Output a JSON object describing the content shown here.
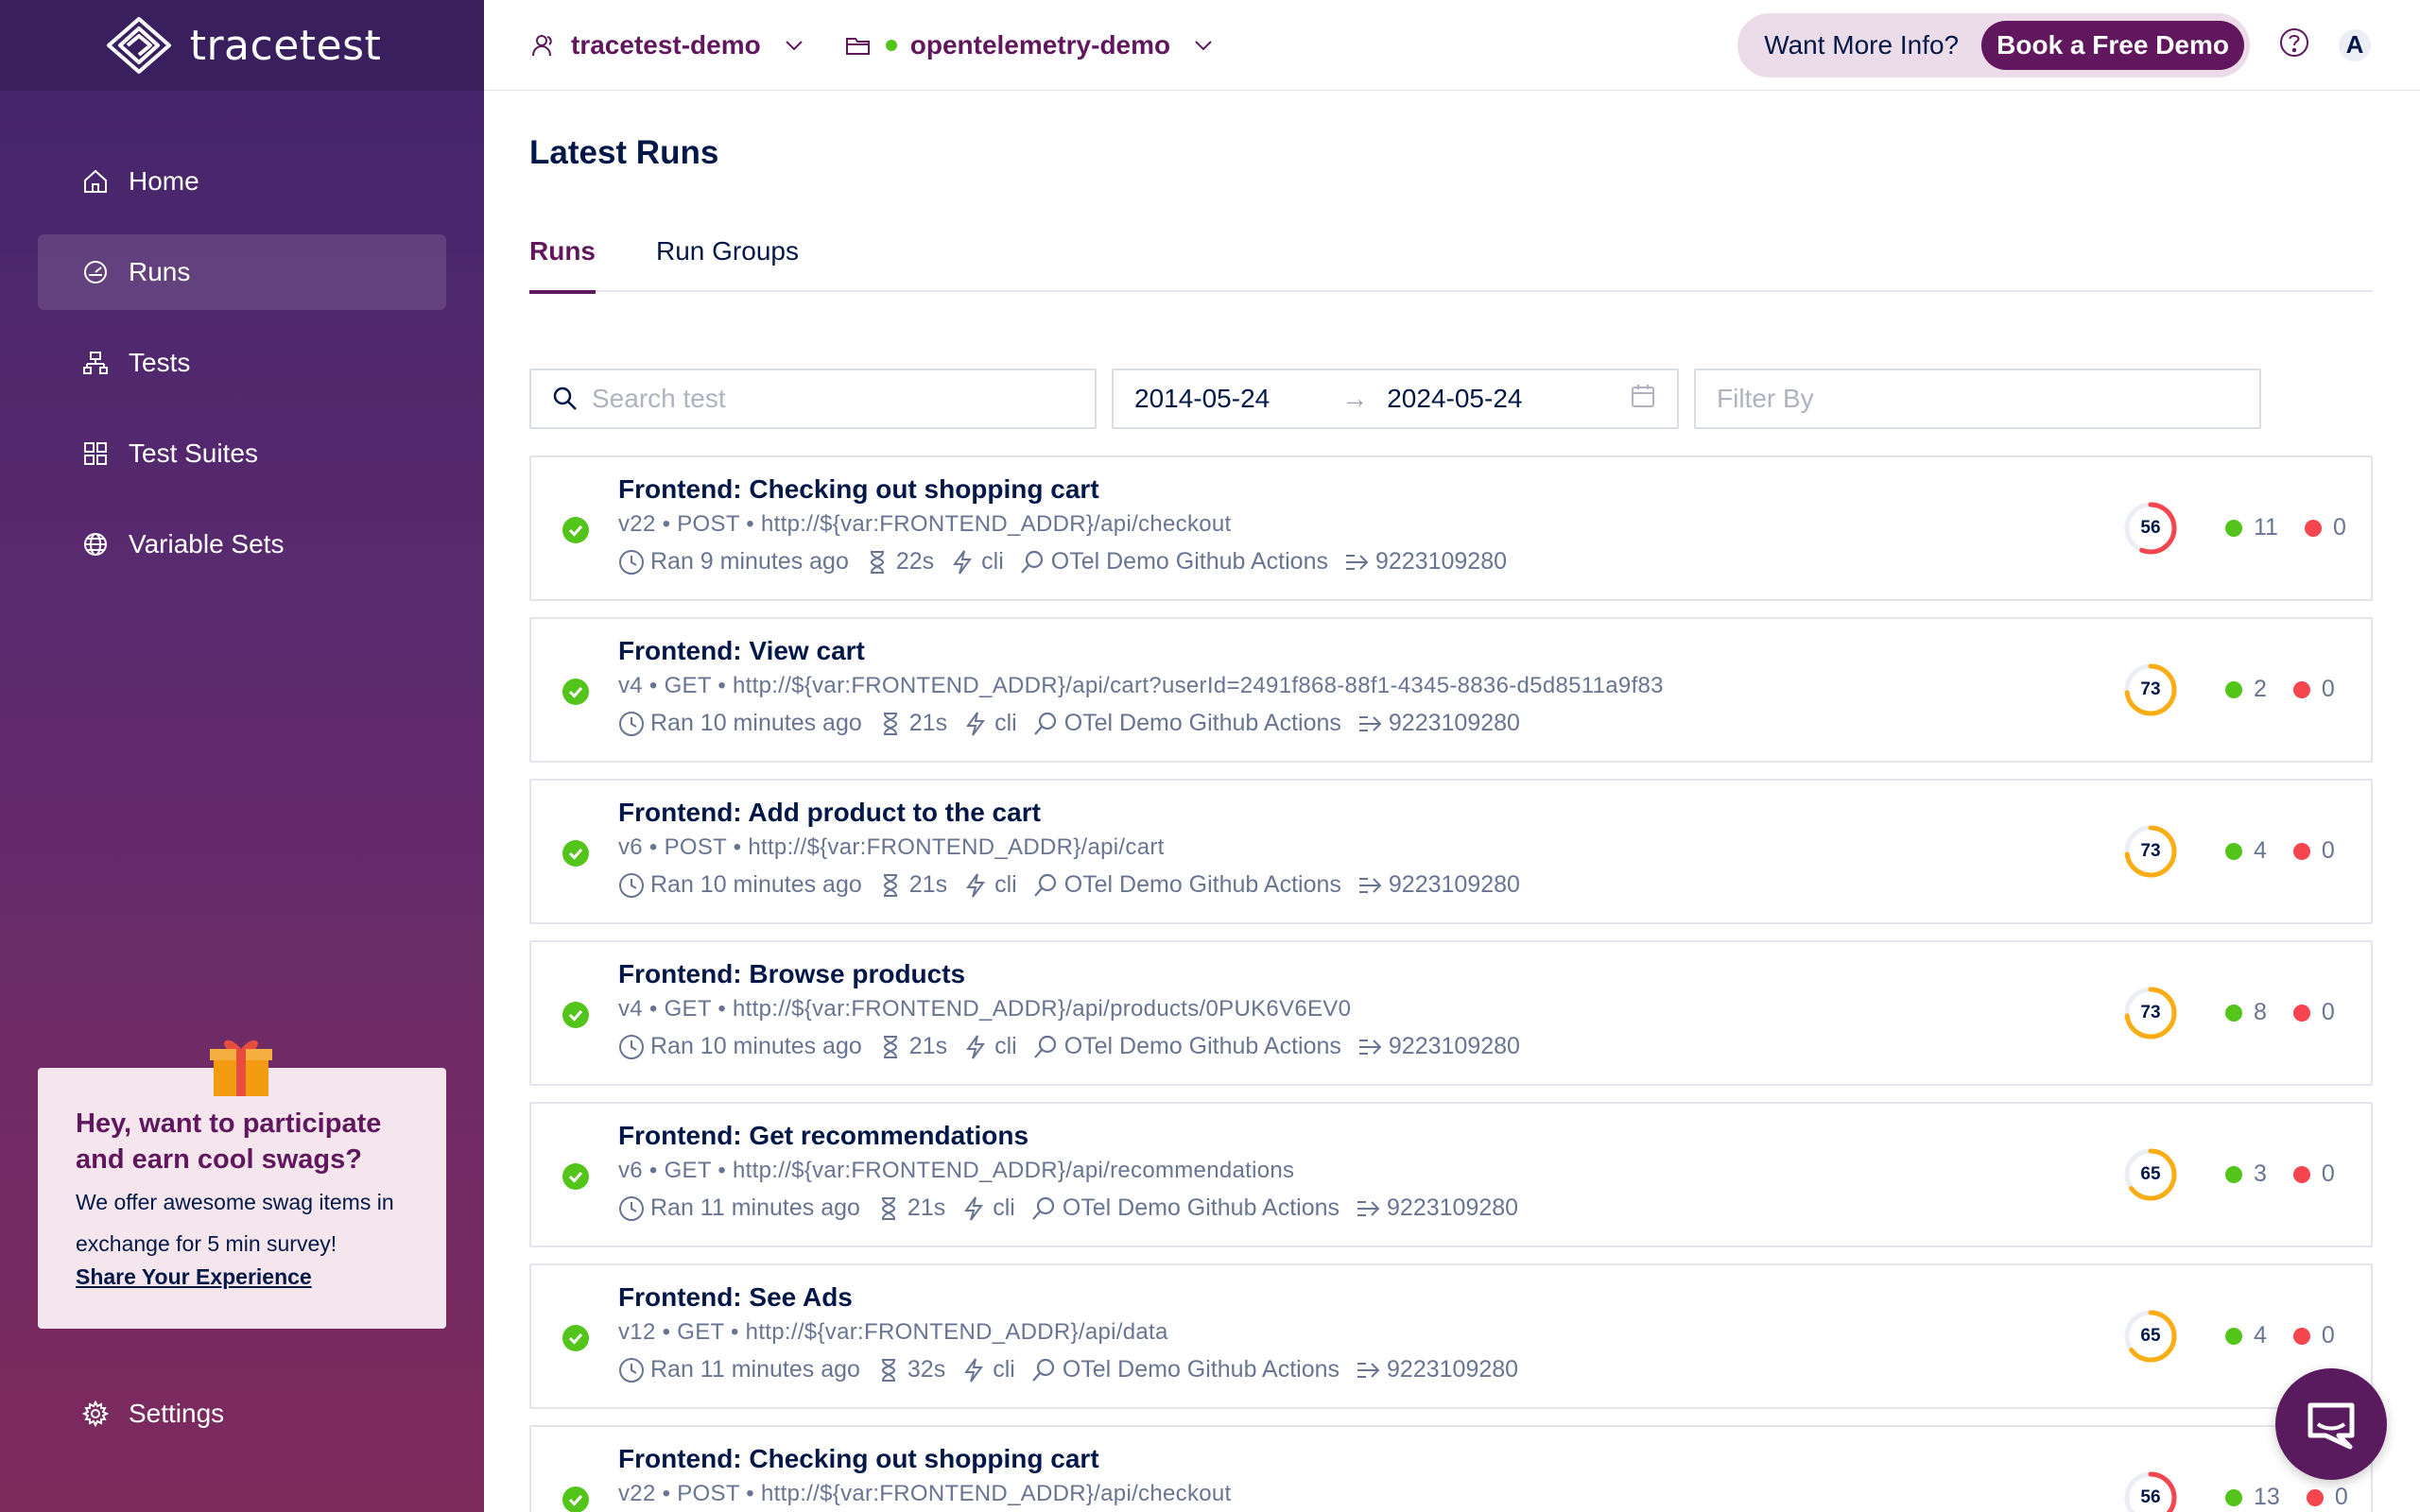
{
  "brand": {
    "name": "tracetest"
  },
  "header": {
    "org": "tracetest-demo",
    "env": "opentelemetry-demo",
    "want_info": "Want More Info?",
    "demo_button": "Book a Free Demo",
    "avatar_letter": "A"
  },
  "sidebar": {
    "items": [
      {
        "label": "Home",
        "icon": "home-icon"
      },
      {
        "label": "Runs",
        "icon": "dashboard-icon",
        "active": true
      },
      {
        "label": "Tests",
        "icon": "tests-icon"
      },
      {
        "label": "Test Suites",
        "icon": "suites-icon"
      },
      {
        "label": "Variable Sets",
        "icon": "globe-icon"
      }
    ],
    "promo": {
      "title": "Hey, want to participate and earn cool swags?",
      "text": "We offer awesome swag items in exchange for 5 min survey!",
      "link": "Share Your Experience"
    },
    "settings": "Settings"
  },
  "main": {
    "title": "Latest Runs",
    "tabs": [
      {
        "label": "Runs",
        "active": true
      },
      {
        "label": "Run Groups",
        "active": false
      }
    ],
    "search_placeholder": "Search test",
    "date_from": "2014-05-24",
    "date_to": "2024-05-24",
    "filter_placeholder": "Filter By"
  },
  "runs": [
    {
      "title": "Frontend: Checking out shopping cart",
      "meta": "v22 • POST • http://${var:FRONTEND_ADDR}/api/checkout",
      "ran": "Ran 9 minutes ago",
      "duration": "22s",
      "trigger": "cli",
      "source": "OTel Demo Github Actions",
      "run_id": "9223109280",
      "score": 56,
      "passed": 11,
      "failed": 0
    },
    {
      "title": "Frontend: View cart",
      "meta": "v4 • GET • http://${var:FRONTEND_ADDR}/api/cart?userId=2491f868-88f1-4345-8836-d5d8511a9f83",
      "ran": "Ran 10 minutes ago",
      "duration": "21s",
      "trigger": "cli",
      "source": "OTel Demo Github Actions",
      "run_id": "9223109280",
      "score": 73,
      "passed": 2,
      "failed": 0
    },
    {
      "title": "Frontend: Add product to the cart",
      "meta": "v6 • POST • http://${var:FRONTEND_ADDR}/api/cart",
      "ran": "Ran 10 minutes ago",
      "duration": "21s",
      "trigger": "cli",
      "source": "OTel Demo Github Actions",
      "run_id": "9223109280",
      "score": 73,
      "passed": 4,
      "failed": 0
    },
    {
      "title": "Frontend: Browse products",
      "meta": "v4 • GET • http://${var:FRONTEND_ADDR}/api/products/0PUK6V6EV0",
      "ran": "Ran 10 minutes ago",
      "duration": "21s",
      "trigger": "cli",
      "source": "OTel Demo Github Actions",
      "run_id": "9223109280",
      "score": 73,
      "passed": 8,
      "failed": 0
    },
    {
      "title": "Frontend: Get recommendations",
      "meta": "v6 • GET • http://${var:FRONTEND_ADDR}/api/recommendations",
      "ran": "Ran 11 minutes ago",
      "duration": "21s",
      "trigger": "cli",
      "source": "OTel Demo Github Actions",
      "run_id": "9223109280",
      "score": 65,
      "passed": 3,
      "failed": 0
    },
    {
      "title": "Frontend: See Ads",
      "meta": "v12 • GET • http://${var:FRONTEND_ADDR}/api/data",
      "ran": "Ran 11 minutes ago",
      "duration": "32s",
      "trigger": "cli",
      "source": "OTel Demo Github Actions",
      "run_id": "9223109280",
      "score": 65,
      "passed": 4,
      "failed": 0
    },
    {
      "title": "Frontend: Checking out shopping cart",
      "meta": "v22 • POST • http://${var:FRONTEND_ADDR}/api/checkout",
      "ran": "",
      "duration": "",
      "trigger": "",
      "source": "",
      "run_id": "",
      "score": 56,
      "passed": 13,
      "failed": 0
    }
  ],
  "colors": {
    "brand_purple": "#61175e",
    "sidebar_top": "#3a1f5e",
    "pass": "#52c41a",
    "fail": "#f5454e",
    "score_low": "#f5454e",
    "score_mid": "#faad14"
  }
}
